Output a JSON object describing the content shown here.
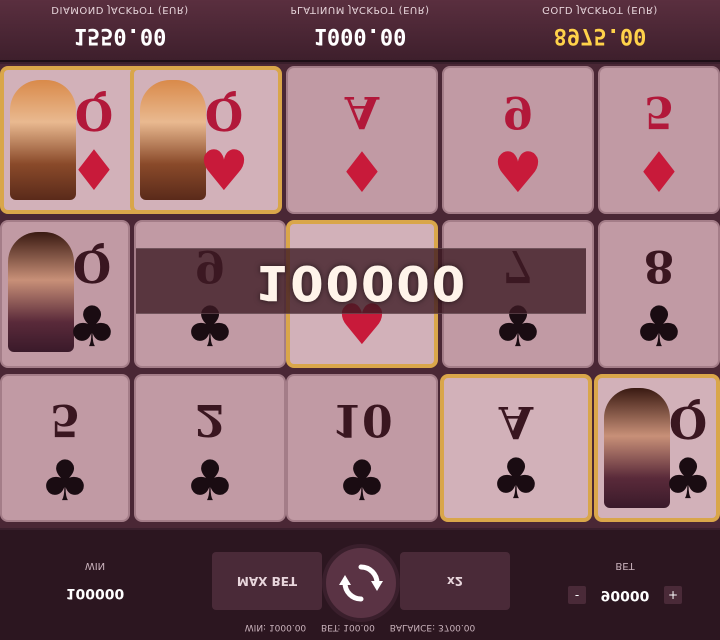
{
  "jackpots": [
    {
      "label": "DIAMOND JACKPOT (EUR)",
      "value": "1550.00"
    },
    {
      "label": "PLATINUM JACKPOT (EUR)",
      "value": "1000.00"
    },
    {
      "label": "GOLD JACKPOT (EUR)",
      "value": "8975.00"
    }
  ],
  "reels": {
    "cards": [
      {
        "rank": "Q",
        "suit": "♦",
        "color": "red"
      },
      {
        "rank": "Q",
        "suit": "♥",
        "color": "red"
      },
      {
        "rank": "A",
        "suit": "♦",
        "color": "red"
      },
      {
        "rank": "9",
        "suit": "♥",
        "color": "red"
      },
      {
        "rank": "5",
        "suit": "♦",
        "color": "red"
      },
      {
        "rank": "Q",
        "suit": "♣",
        "color": "black"
      },
      {
        "rank": "9",
        "suit": "♣",
        "color": "black"
      },
      {
        "rank": "",
        "suit": "♥",
        "color": "red"
      },
      {
        "rank": "7",
        "suit": "♣",
        "color": "black"
      },
      {
        "rank": "8",
        "suit": "♣",
        "color": "black"
      },
      {
        "rank": "5",
        "suit": "♣",
        "color": "black"
      },
      {
        "rank": "2",
        "suit": "♣",
        "color": "black"
      },
      {
        "rank": "10",
        "suit": "♣",
        "color": "black"
      },
      {
        "rank": "A",
        "suit": "♣",
        "color": "black"
      },
      {
        "rank": "Q",
        "suit": "♣",
        "color": "black"
      }
    ]
  },
  "win_banner": "100000",
  "controls": {
    "win_label": "WIN",
    "win_value": "100000",
    "max_bet_label": "MAX BET",
    "multiplier_label": "x2",
    "bet_label": "BET",
    "bet_value": "90000",
    "bet_minus": "-",
    "bet_plus": "+"
  },
  "status": {
    "win": "WIN: 1000.00",
    "bet": "BET: 100.00",
    "balance": "BALANCE: 3700.00"
  },
  "colors": {
    "gold_accent": "#ffd24a",
    "frame_gold": "#d9a64a",
    "suit_red": "#c81a3a"
  }
}
